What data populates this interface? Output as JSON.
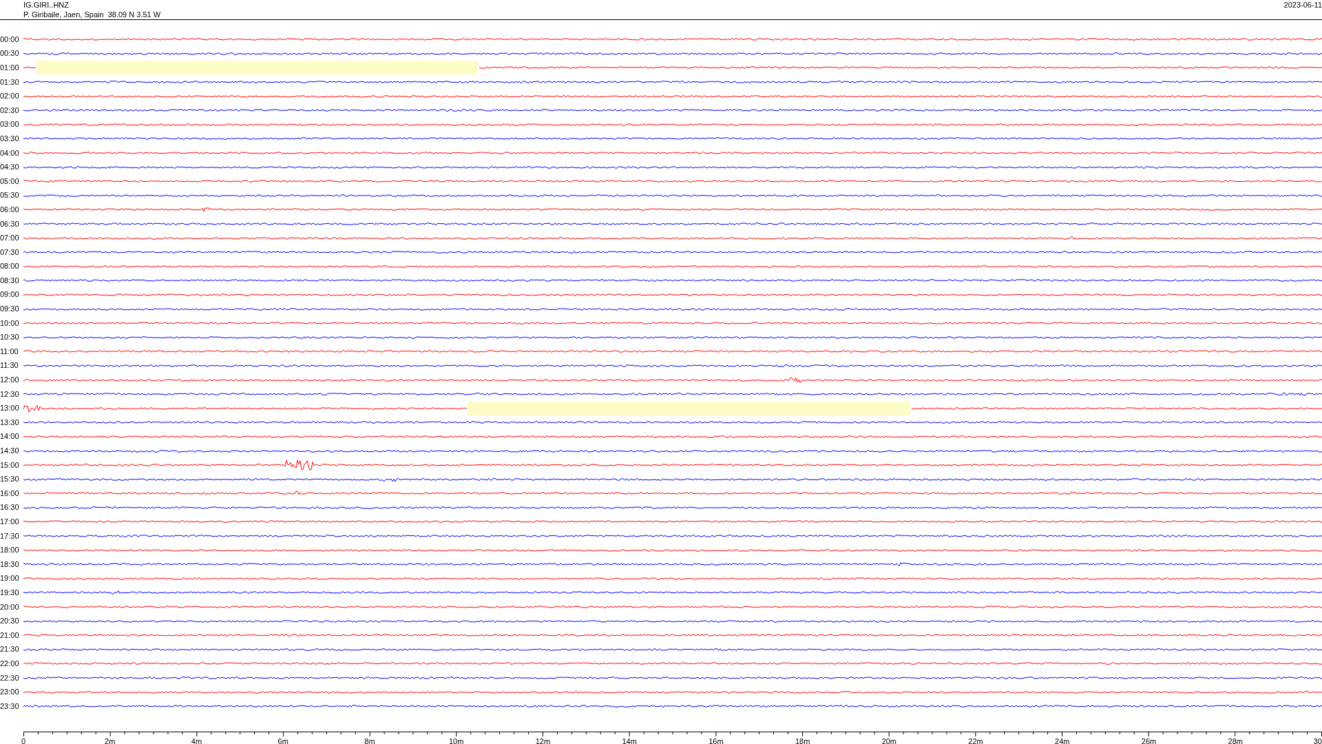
{
  "header": {
    "station": "IG.GIRI..HNZ",
    "location": "P. Giribaile, Jaen, Spain  38.09 N 3.51 W",
    "date": "2023-06-11"
  },
  "rows": [
    {
      "label": "00:00",
      "color": "#ff0000"
    },
    {
      "label": "00:30",
      "color": "#0000ff"
    },
    {
      "label": "01:00",
      "color": "#ff0000"
    },
    {
      "label": "01:30",
      "color": "#0000ff"
    },
    {
      "label": "02:00",
      "color": "#ff0000"
    },
    {
      "label": "02:30",
      "color": "#0000ff"
    },
    {
      "label": "03:00",
      "color": "#ff0000"
    },
    {
      "label": "03:30",
      "color": "#0000ff"
    },
    {
      "label": "04:00",
      "color": "#ff0000"
    },
    {
      "label": "04:30",
      "color": "#0000ff"
    },
    {
      "label": "05:00",
      "color": "#ff0000"
    },
    {
      "label": "05:30",
      "color": "#0000ff"
    },
    {
      "label": "06:00",
      "color": "#ff0000"
    },
    {
      "label": "06:30",
      "color": "#0000ff"
    },
    {
      "label": "07:00",
      "color": "#ff0000"
    },
    {
      "label": "07:30",
      "color": "#0000ff"
    },
    {
      "label": "08:00",
      "color": "#ff0000"
    },
    {
      "label": "08:30",
      "color": "#0000ff"
    },
    {
      "label": "09:00",
      "color": "#ff0000"
    },
    {
      "label": "09:30",
      "color": "#0000ff"
    },
    {
      "label": "10:00",
      "color": "#ff0000"
    },
    {
      "label": "10:30",
      "color": "#0000ff"
    },
    {
      "label": "11:00",
      "color": "#ff0000"
    },
    {
      "label": "11:30",
      "color": "#0000ff"
    },
    {
      "label": "12:00",
      "color": "#ff0000"
    },
    {
      "label": "12:30",
      "color": "#0000ff"
    },
    {
      "label": "13:00",
      "color": "#ff0000"
    },
    {
      "label": "13:30",
      "color": "#0000ff"
    },
    {
      "label": "14:00",
      "color": "#ff0000"
    },
    {
      "label": "14:30",
      "color": "#0000ff"
    },
    {
      "label": "15:00",
      "color": "#ff0000"
    },
    {
      "label": "15:30",
      "color": "#0000ff"
    },
    {
      "label": "16:00",
      "color": "#ff0000"
    },
    {
      "label": "16:30",
      "color": "#0000ff"
    },
    {
      "label": "17:00",
      "color": "#ff0000"
    },
    {
      "label": "17:30",
      "color": "#0000ff"
    },
    {
      "label": "18:00",
      "color": "#ff0000"
    },
    {
      "label": "18:30",
      "color": "#0000ff"
    },
    {
      "label": "19:00",
      "color": "#ff0000"
    },
    {
      "label": "19:30",
      "color": "#0000ff"
    },
    {
      "label": "20:00",
      "color": "#ff0000"
    },
    {
      "label": "20:30",
      "color": "#0000ff"
    },
    {
      "label": "21:00",
      "color": "#ff0000"
    },
    {
      "label": "21:30",
      "color": "#0000ff"
    },
    {
      "label": "22:00",
      "color": "#ff0000"
    },
    {
      "label": "22:30",
      "color": "#0000ff"
    },
    {
      "label": "23:00",
      "color": "#ff0000"
    },
    {
      "label": "23:30",
      "color": "#0000ff"
    }
  ],
  "x_axis": {
    "ticks": [
      "0",
      "2m",
      "4m",
      "6m",
      "8m",
      "10m",
      "12m",
      "14m",
      "16m",
      "18m",
      "20m",
      "22m",
      "24m",
      "26m",
      "28m",
      "30"
    ]
  }
}
